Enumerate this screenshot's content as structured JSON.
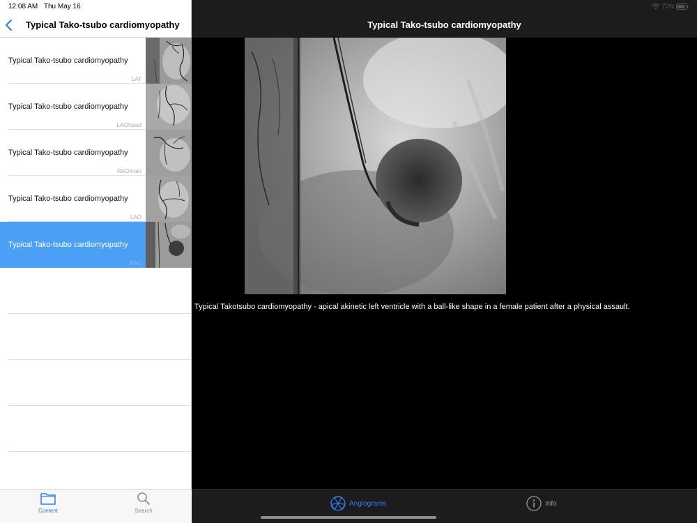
{
  "status": {
    "time": "12:08 AM",
    "date": "Thu May 16",
    "battery": "72%"
  },
  "nav": {
    "title": "Typical Tako-tsubo cardiomyopathy"
  },
  "list": [
    {
      "label": "Typical Tako-tsubo cardiomyopathy",
      "view": "LAT"
    },
    {
      "label": "Typical Tako-tsubo cardiomyopathy",
      "view": "LAO/caud"
    },
    {
      "label": "Typical Tako-tsubo cardiomyopathy",
      "view": "RAO/cran"
    },
    {
      "label": "Typical Tako-tsubo cardiomyopathy",
      "view": "LAO"
    },
    {
      "label": "Typical Tako-tsubo cardiomyopathy",
      "view": "RAO"
    }
  ],
  "left_tabs": {
    "content": "Content",
    "search": "Search"
  },
  "detail": {
    "title": "Typical Tako-tsubo cardiomyopathy",
    "caption": "Typical Takotsubo cardiomyopathy - apical akinetic left ventricle with a ball-like shape in a female patient after a physical assault."
  },
  "right_tabs": {
    "angiograms": "Angiograms",
    "info": "Info"
  },
  "colors": {
    "accent": "#2f7ef2",
    "selected_row": "#4aa0f5"
  }
}
